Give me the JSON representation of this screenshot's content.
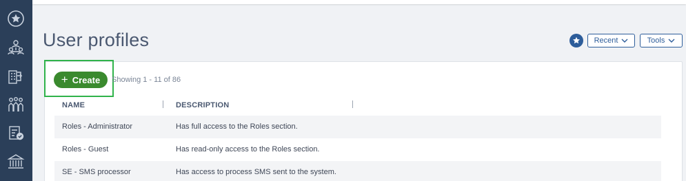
{
  "sidebar": {
    "icons": [
      "star-circle-icon",
      "users-network-icon",
      "building-arrow-icon",
      "people-group-icon",
      "clipboard-check-icon",
      "bank-building-icon"
    ]
  },
  "header": {
    "title": "User profiles",
    "recent_label": "Recent",
    "tools_label": "Tools"
  },
  "toolbar": {
    "create_label": "Create",
    "showing_text": "Showing 1 - 11 of 86"
  },
  "table": {
    "columns": [
      "NAME",
      "DESCRIPTION"
    ],
    "rows": [
      {
        "name": "Roles - Administrator",
        "description": "Has full access to the Roles section."
      },
      {
        "name": "Roles - Guest",
        "description": "Has read-only access to the Roles section."
      },
      {
        "name": "SE - SMS processor",
        "description": "Has access to process SMS sent to the system."
      }
    ]
  },
  "colors": {
    "sidebar_bg": "#2b3f59",
    "accent_blue": "#2d5d9a",
    "create_green": "#3a8a2e",
    "highlight_green": "#2fb34a"
  }
}
